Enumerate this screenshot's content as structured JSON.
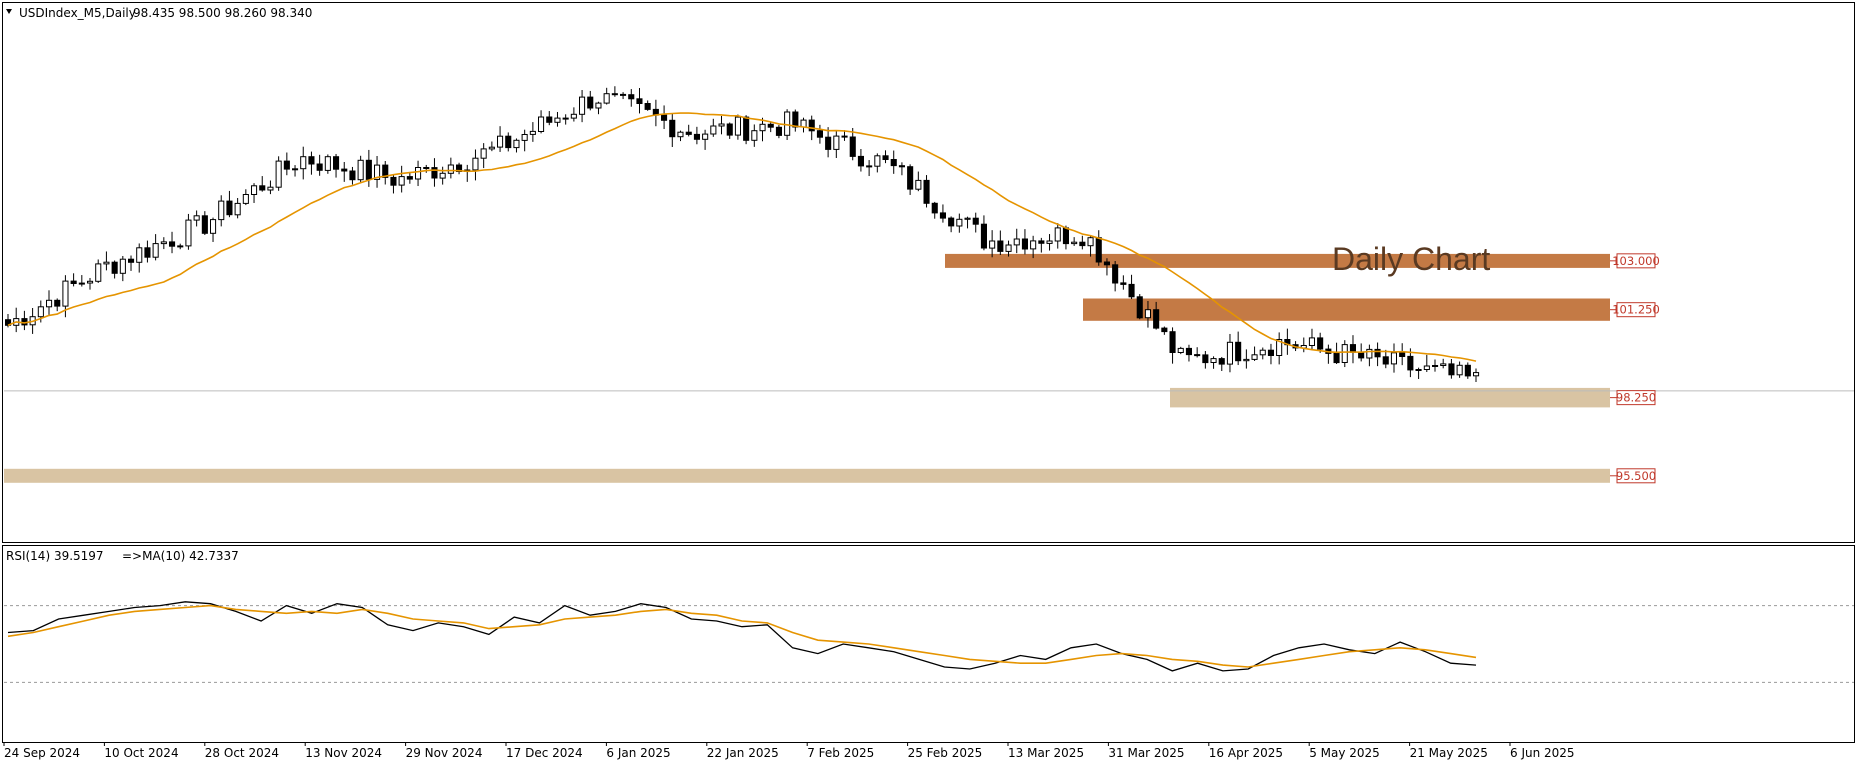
{
  "header": {
    "symbol_label": "USDIndex_M5,Daily",
    "ohlc": "98.435 98.500 98.260 98.340"
  },
  "rsi_header": {
    "label": "RSI(14) 39.5197",
    "ma_label": "=>MA(10) 42.7337"
  },
  "annotation": {
    "text": "Daily Chart"
  },
  "colors": {
    "bull_candle": "#ffffff",
    "bear_candle": "#000000",
    "ma_line": "#e59400",
    "rsi_line": "#000000",
    "rsi_ma_line": "#e59400",
    "resistance_zone": "#c47a45",
    "support_zone": "#d9c4a3",
    "level_label": "#c0392b"
  },
  "chart_data": [
    {
      "type": "candlestick",
      "title": "USDIndex_M5,Daily",
      "x_tick_labels": [
        "24 Sep 2024",
        "10 Oct 2024",
        "28 Oct 2024",
        "13 Nov 2024",
        "29 Nov 2024",
        "17 Dec 2024",
        "6 Jan 2025",
        "22 Jan 2025",
        "7 Feb 2025",
        "25 Feb 2025",
        "13 Mar 2025",
        "31 Mar 2025",
        "16 Apr 2025",
        "5 May 2025",
        "21 May 2025",
        "6 Jun 2025"
      ],
      "close_path": [
        {
          "t": "24 Sep 2024",
          "close": 100.7
        },
        {
          "t": "10 Oct 2024",
          "close": 102.8
        },
        {
          "t": "28 Oct 2024",
          "close": 104.3
        },
        {
          "t": "13 Nov 2024",
          "close": 106.7
        },
        {
          "t": "29 Nov 2024",
          "close": 105.9
        },
        {
          "t": "17 Dec 2024",
          "close": 107.0
        },
        {
          "t": "6 Jan 2025",
          "close": 108.9
        },
        {
          "t": "22 Jan 2025",
          "close": 107.6
        },
        {
          "t": "7 Feb 2025",
          "close": 107.9
        },
        {
          "t": "25 Feb 2025",
          "close": 106.4
        },
        {
          "t": "13 Mar 2025",
          "close": 103.7
        },
        {
          "t": "31 Mar 2025",
          "close": 104.0
        },
        {
          "t": "16 Apr 2025",
          "close": 99.4
        },
        {
          "t": "5 May 2025",
          "close": 100.1
        },
        {
          "t": "21 May 2025",
          "close": 99.4
        },
        {
          "t": "6 Jun 2025",
          "close": 98.7
        }
      ],
      "moving_average": {
        "color": "#e59400"
      },
      "zones": [
        {
          "label": "103.000",
          "low": 102.75,
          "high": 103.25,
          "kind": "resistance"
        },
        {
          "label": "101.250",
          "low": 100.85,
          "high": 101.65,
          "kind": "resistance"
        },
        {
          "label": "98.250",
          "low": 97.75,
          "high": 98.45,
          "kind": "support"
        },
        {
          "label": "95.500",
          "low": 95.05,
          "high": 95.55,
          "kind": "support"
        }
      ],
      "current_price": 98.34,
      "ylim": [
        93.0,
        112.2
      ]
    },
    {
      "type": "line",
      "title": "RSI(14) 39.5197",
      "series": [
        {
          "name": "RSI(14)",
          "values": [
            56,
            57,
            63,
            65,
            67,
            69,
            70,
            72,
            71,
            67,
            62,
            70,
            66,
            71,
            69,
            60,
            57,
            61,
            59,
            55,
            64,
            61,
            70,
            65,
            67,
            71,
            69,
            63,
            62,
            59,
            60,
            48,
            45,
            50,
            48,
            46,
            42,
            38,
            37,
            40,
            44,
            42,
            48,
            50,
            45,
            42,
            36,
            40,
            36,
            37,
            44,
            48,
            50,
            47,
            45,
            51,
            46,
            40,
            39
          ]
        },
        {
          "name": "MA(10)",
          "values": [
            54,
            56,
            59,
            62,
            65,
            67,
            68,
            69,
            70,
            68,
            67,
            66,
            67,
            66,
            68,
            66,
            63,
            62,
            61,
            58,
            59,
            60,
            63,
            64,
            65,
            67,
            68,
            66,
            65,
            62,
            61,
            56,
            52,
            51,
            50,
            48,
            46,
            44,
            42,
            41,
            40,
            40,
            42,
            44,
            45,
            44,
            42,
            41,
            39,
            38,
            40,
            42,
            44,
            46,
            47,
            48,
            47,
            45,
            43
          ]
        }
      ],
      "ylim": [
        0,
        100
      ],
      "reference_lines": [
        30,
        70
      ]
    }
  ]
}
